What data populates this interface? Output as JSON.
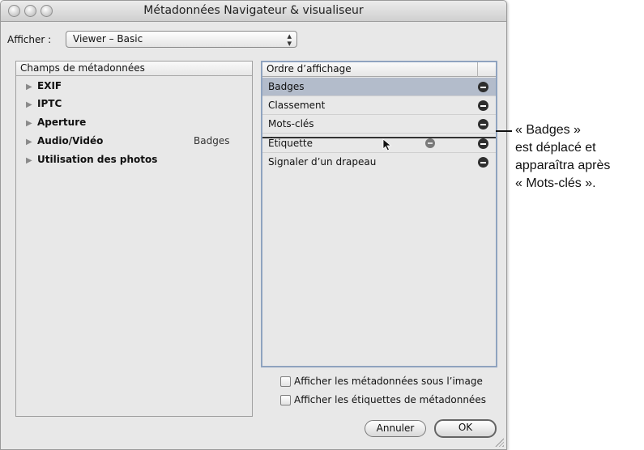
{
  "window": {
    "title": "Métadonnées Navigateur & visualiseur"
  },
  "toolbar": {
    "afficher_label": "Afficher :",
    "view_select_value": "Viewer – Basic"
  },
  "left_panel": {
    "header": "Champs de métadonnées",
    "items": [
      {
        "label": "EXIF"
      },
      {
        "label": "IPTC"
      },
      {
        "label": "Aperture"
      },
      {
        "label": "Audio/Vidéo"
      },
      {
        "label": "Utilisation des photos"
      }
    ],
    "hover_label": "Badges"
  },
  "right_panel": {
    "header": "Ordre d’affichage",
    "items": [
      {
        "label": "Badges",
        "selected": true
      },
      {
        "label": "Classement",
        "selected": false
      },
      {
        "label": "Mots-clés",
        "selected": false
      },
      {
        "label": "Étiquette",
        "selected": false
      },
      {
        "label": "Signaler d’un drapeau",
        "selected": false
      }
    ]
  },
  "options": {
    "show_below_image": "Afficher les métadonnées sous l’image",
    "show_labels": "Afficher les étiquettes de métadonnées"
  },
  "buttons": {
    "cancel": "Annuler",
    "ok": "OK"
  },
  "callout": {
    "line1": "« Badges »",
    "line2": "est déplacé et",
    "line3": "apparaîtra après",
    "line4": "« Mots-clés »."
  },
  "colors": {
    "selection": "#b3bccb",
    "window_bg": "#e8e8e8"
  }
}
